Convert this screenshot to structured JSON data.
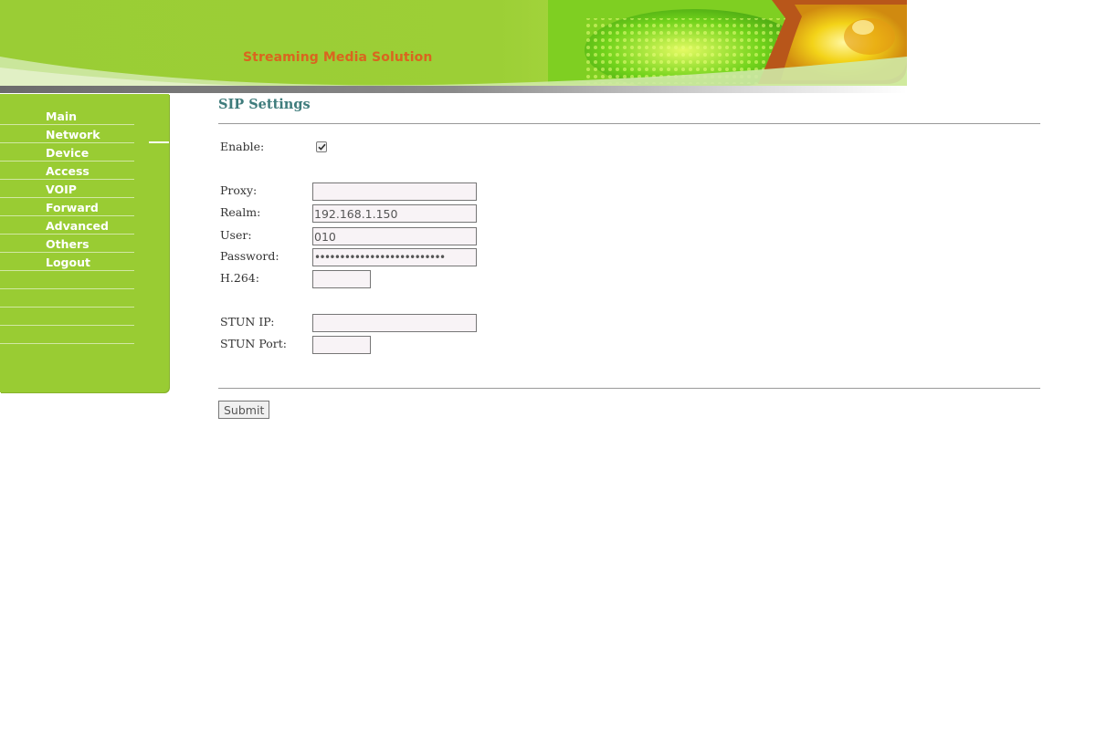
{
  "header": {
    "tagline": "Streaming Media Solution"
  },
  "sidebar": {
    "items": [
      {
        "label": "Main"
      },
      {
        "label": "Network"
      },
      {
        "label": "Device"
      },
      {
        "label": "Access"
      },
      {
        "label": "VOIP"
      },
      {
        "label": "Forward"
      },
      {
        "label": "Advanced"
      },
      {
        "label": "Others"
      },
      {
        "label": "Logout"
      }
    ],
    "active_item": "Network"
  },
  "page": {
    "title": "SIP Settings"
  },
  "form": {
    "enable": {
      "label": "Enable:",
      "checked": true
    },
    "proxy": {
      "label": "Proxy:",
      "value": ""
    },
    "realm": {
      "label": "Realm:",
      "value": "192.168.1.150"
    },
    "user": {
      "label": "User:",
      "value": "010"
    },
    "password": {
      "label": "Password:",
      "value": "••••••••••••••••••••••••••"
    },
    "h264": {
      "label": "H.264:",
      "value": ""
    },
    "stun_ip": {
      "label": "STUN IP:",
      "value": ""
    },
    "stun_port": {
      "label": "STUN Port:",
      "value": ""
    },
    "submit_label": "Submit"
  },
  "colors": {
    "sidebar_green": "#99cc33",
    "tagline_orange": "#d9651f",
    "title_teal": "#3f7c7c"
  }
}
